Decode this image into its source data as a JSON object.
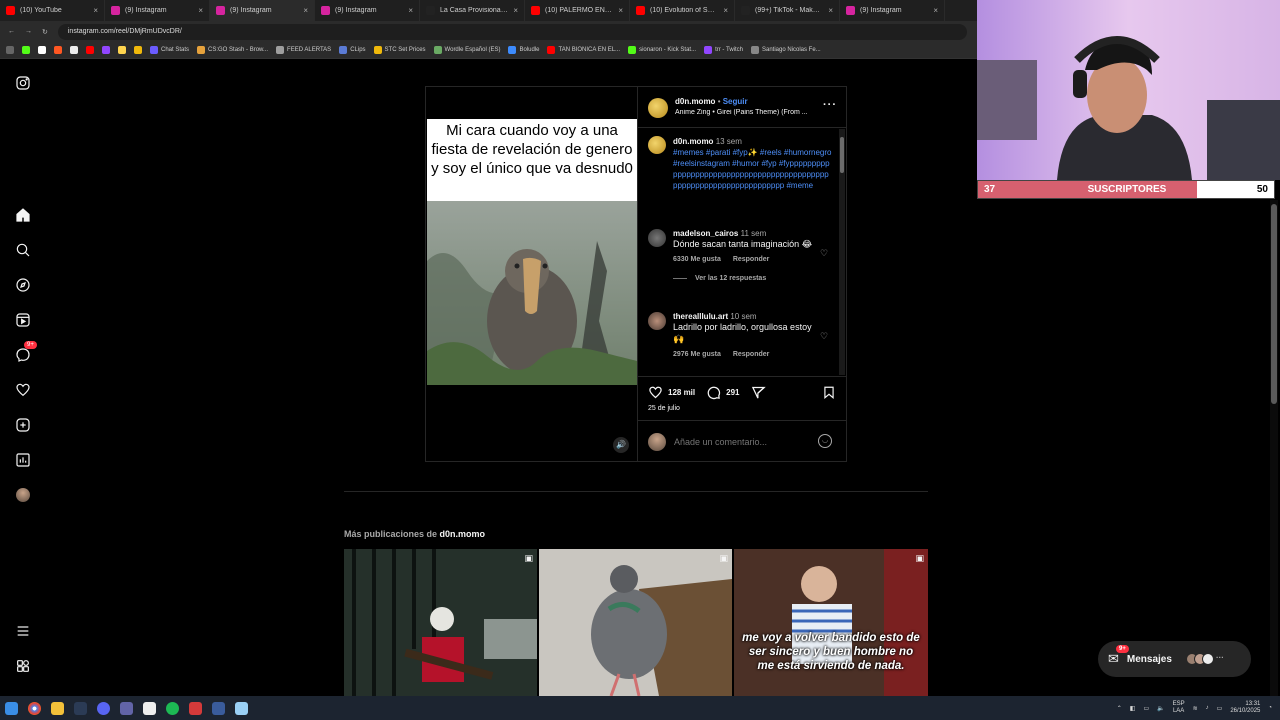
{
  "browser": {
    "tabs": [
      {
        "title": "(10) YouTube",
        "color": "#ff0000"
      },
      {
        "title": "(9) Instagram",
        "color": "#d6249f"
      },
      {
        "title": "(9) Instagram",
        "color": "#d6249f"
      },
      {
        "title": "(9) Instagram",
        "color": "#d6249f"
      },
      {
        "title": "La Casa Provisional de Ve",
        "color": "#222222"
      },
      {
        "title": "(10) PALERMO EN LA PER",
        "color": "#ff0000"
      },
      {
        "title": "(10) Evolution of Sub-Zer",
        "color": "#ff0000"
      },
      {
        "title": "(99+) TikTok - Make Your",
        "color": "#222222"
      },
      {
        "title": "(9) Instagram",
        "color": "#d6249f"
      }
    ],
    "url": "instagram.com/reel/DMjRmUDvcDR/",
    "bookmarks": [
      {
        "label": "Chat Stats",
        "color": "#6b5cff"
      },
      {
        "label": "CS:GO Stash - Brow...",
        "color": "#e6a23c"
      },
      {
        "label": "FEED ALERTAS",
        "color": "#9e9e9e"
      },
      {
        "label": "CLips",
        "color": "#5b7bd5"
      },
      {
        "label": "STC Set Prices",
        "color": "#f0b90b"
      },
      {
        "label": "Wordle Español (ES)",
        "color": "#6aaa64"
      },
      {
        "label": "Boludle",
        "color": "#3d8bfd"
      },
      {
        "label": "TAN BIONICA EN EL...",
        "color": "#ff0000"
      },
      {
        "label": "sionaron - Kick Stat...",
        "color": "#53fc18"
      },
      {
        "label": "trr - Twitch",
        "color": "#9146ff"
      },
      {
        "label": "Santiago Nicolas Fe...",
        "color": "#888888"
      }
    ]
  },
  "post": {
    "video_caption": "Mi cara cuando voy a una fiesta de revelación de genero y soy el único que va desnud0",
    "author": "d0n.momo",
    "follow_label": "Seguir",
    "audio": "Anime Zing • Girei (Pains Theme) (From ...",
    "caption": {
      "user": "d0n.momo",
      "time": "13 sem",
      "text": "#memes #parati #fyp✨ #reels #humornegro #reelsinstagram #humor #fyp #fyppppppppppppppppppppppppppppppppppppppppppppppppppppppppppppppppppppp #meme"
    },
    "comments": [
      {
        "user": "madelson_cairos",
        "time": "11 sem",
        "text": "Dónde sacan tanta imaginación 😂",
        "likes": "6330 Me gusta",
        "reply": "Responder",
        "replies": "Ver las 12 respuestas"
      },
      {
        "user": "therealllulu.art",
        "time": "10 sem",
        "text": "Ladrillo por ladrillo, orgullosa estoy 🙌",
        "likes": "2976 Me gusta",
        "reply": "Responder"
      }
    ],
    "likes_count": "128 mil",
    "comments_count": "291",
    "date": "25 de julio",
    "comment_placeholder": "Añade un comentario..."
  },
  "more": {
    "prefix": "Más publicaciones de",
    "user": "d0n.momo",
    "thumb3_text": "me voy a volver bandido esto de ser sincero y buen hombre no me está sirviendo de nada."
  },
  "nav": {
    "badge": "9+"
  },
  "messages": {
    "label": "Mensajes",
    "badge": "9+"
  },
  "stream": {
    "subs_current": "37",
    "subs_label": "SUSCRIPTORES",
    "subs_goal": "50",
    "subs_progress": 0.74
  },
  "taskbar": {
    "lang": "ESP",
    "layout": "LAA",
    "time": "13:31",
    "date": "26/10/2025"
  }
}
